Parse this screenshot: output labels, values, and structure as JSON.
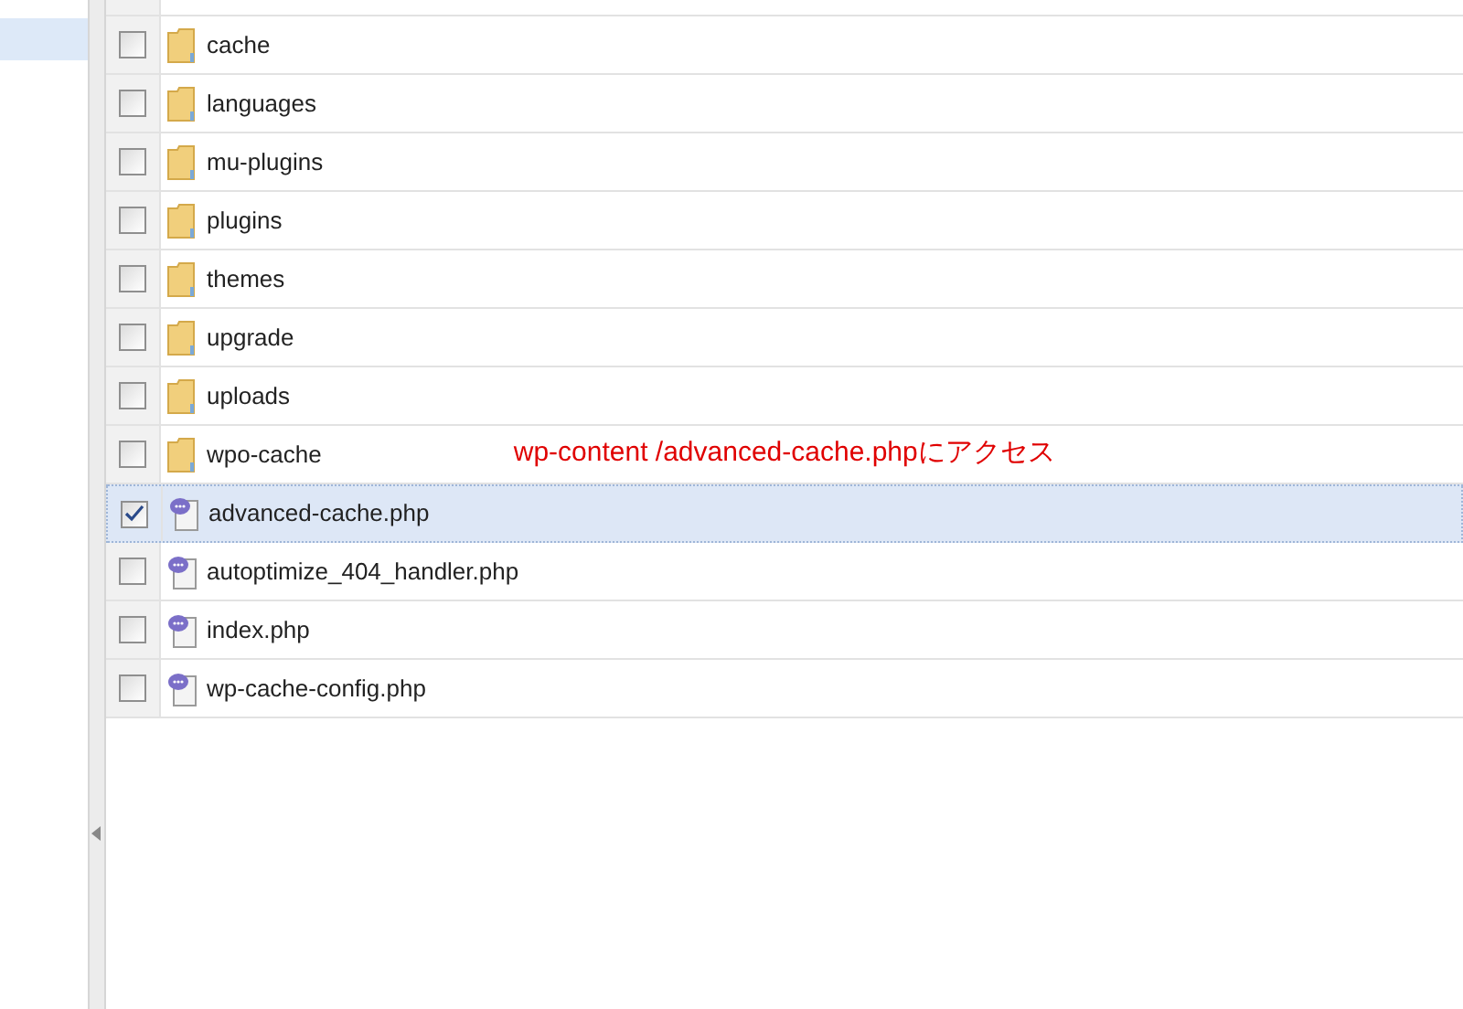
{
  "sidebar": {
    "items": [
      {
        "selected": true
      }
    ]
  },
  "files": [
    {
      "name": "cache",
      "kind": "folder",
      "checked": false,
      "selected": false
    },
    {
      "name": "languages",
      "kind": "folder",
      "checked": false,
      "selected": false
    },
    {
      "name": "mu-plugins",
      "kind": "folder",
      "checked": false,
      "selected": false
    },
    {
      "name": "plugins",
      "kind": "folder",
      "checked": false,
      "selected": false
    },
    {
      "name": "themes",
      "kind": "folder",
      "checked": false,
      "selected": false
    },
    {
      "name": "upgrade",
      "kind": "folder",
      "checked": false,
      "selected": false
    },
    {
      "name": "uploads",
      "kind": "folder",
      "checked": false,
      "selected": false
    },
    {
      "name": "wpo-cache",
      "kind": "folder",
      "checked": false,
      "selected": false,
      "note": "wp-content /advanced-cache.phpにアクセス"
    },
    {
      "name": "advanced-cache.php",
      "kind": "php",
      "checked": true,
      "selected": true
    },
    {
      "name": "autoptimize_404_handler.php",
      "kind": "php",
      "checked": false,
      "selected": false
    },
    {
      "name": "index.php",
      "kind": "php",
      "checked": false,
      "selected": false
    },
    {
      "name": "wp-cache-config.php",
      "kind": "php",
      "checked": false,
      "selected": false
    }
  ]
}
